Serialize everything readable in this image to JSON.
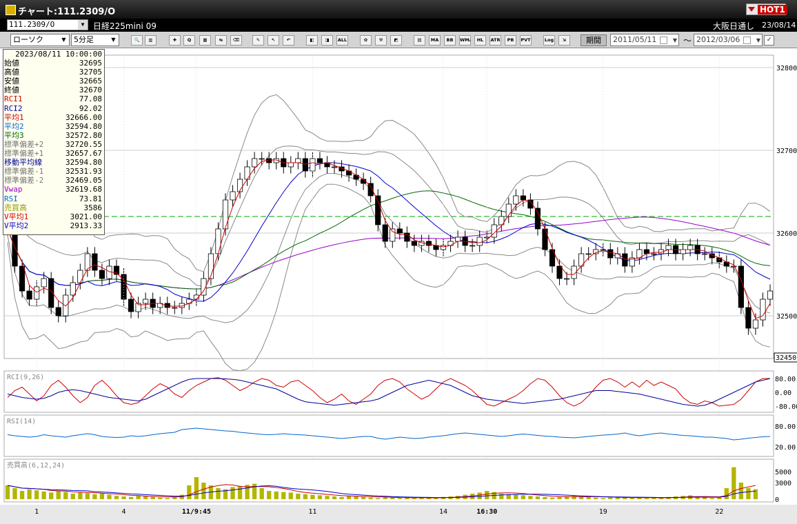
{
  "window": {
    "title": "チャート:111.2309/O",
    "hot_label": "HOT1"
  },
  "toolbar1": {
    "symbol": "111.2309/O",
    "product": "日経225mini 09",
    "session": "大阪日通し",
    "date": "23/08/14"
  },
  "toolbar2": {
    "chart_type": "ローソク",
    "interval": "5分足",
    "buttons": [
      {
        "name": "zoom-icon",
        "label": "🔍"
      },
      {
        "name": "scroll-icon",
        "label": "▥"
      },
      {
        "name": "cross-icon",
        "label": "✚"
      },
      {
        "name": "search-price-icon",
        "label": "Q"
      },
      {
        "name": "grid-icon",
        "label": "▦"
      },
      {
        "name": "split-icon",
        "label": "⇆"
      },
      {
        "name": "eraser-icon",
        "label": "⌫"
      },
      {
        "name": "pencil-icon",
        "label": "✎"
      },
      {
        "name": "cursor-icon",
        "label": "↖"
      },
      {
        "name": "undo-icon",
        "label": "↶"
      },
      {
        "name": "candle-left-icon",
        "label": "◧"
      },
      {
        "name": "candle-right-icon",
        "label": "◨"
      },
      {
        "name": "all-icon",
        "label": "ALL"
      },
      {
        "name": "gear-icon",
        "label": "✿"
      },
      {
        "name": "tool-icon",
        "label": "⚒"
      },
      {
        "name": "color-icon",
        "label": "◩"
      },
      {
        "name": "grid2-icon",
        "label": "▤"
      },
      {
        "name": "ma-icon",
        "label": "MA"
      },
      {
        "name": "bb-icon",
        "label": "BB"
      },
      {
        "name": "wma-icon",
        "label": "WMA"
      },
      {
        "name": "hl-icon",
        "label": "HL"
      },
      {
        "name": "atr-icon",
        "label": "ATR"
      },
      {
        "name": "pb-icon",
        "label": "PB"
      },
      {
        "name": "pvt-icon",
        "label": "PVT"
      },
      {
        "name": "log-icon",
        "label": "Log"
      },
      {
        "name": "exit-icon",
        "label": "⇲"
      }
    ],
    "period_label": "期間",
    "date_from": "2011/05/11",
    "date_to": "2012/03/06",
    "tilde": "〜",
    "check": "✓"
  },
  "info_panel": {
    "datetime": "2023/08/11  10:00:00",
    "rows": [
      {
        "label": "始値",
        "value": "32695",
        "color": "#000000"
      },
      {
        "label": "高値",
        "value": "32705",
        "color": "#000000"
      },
      {
        "label": "安値",
        "value": "32665",
        "color": "#000000"
      },
      {
        "label": "終値",
        "value": "32670",
        "color": "#000000"
      },
      {
        "label": "RCI1",
        "value": "77.08",
        "color": "#cc0000"
      },
      {
        "label": "RCI2",
        "value": "92.02",
        "color": "#000099"
      },
      {
        "label": "平均1",
        "value": "32666.00",
        "color": "#cc0000"
      },
      {
        "label": "平均2",
        "value": "32594.80",
        "color": "#0066cc"
      },
      {
        "label": "平均3",
        "value": "32572.80",
        "color": "#006600"
      },
      {
        "label": "標準偏差+2",
        "value": "32720.55",
        "color": "#777777"
      },
      {
        "label": "標準偏差+1",
        "value": "32657.67",
        "color": "#777777"
      },
      {
        "label": "移動平均線",
        "value": "32594.80",
        "color": "#000099"
      },
      {
        "label": "標準偏差-1",
        "value": "32531.93",
        "color": "#777777"
      },
      {
        "label": "標準偏差-2",
        "value": "32469.05",
        "color": "#777777"
      },
      {
        "label": "Vwap",
        "value": "32619.68",
        "color": "#9900cc"
      },
      {
        "label": "RSI",
        "value": "73.81",
        "color": "#0066cc"
      },
      {
        "label": "売買高",
        "value": "3586",
        "color": "#999900"
      },
      {
        "label": "V平均1",
        "value": "3021.00",
        "color": "#cc0000"
      },
      {
        "label": "V平均2",
        "value": "2913.33",
        "color": "#0000cc"
      }
    ]
  },
  "chart_data": {
    "type": "candlestick",
    "price_axis": {
      "min": 32450,
      "max": 32800,
      "ticks": [
        32800,
        32700,
        32600,
        32500
      ],
      "current_label": "32450"
    },
    "x_labels": [
      "1",
      "4",
      "11/9:45",
      "11",
      "14",
      "16:30",
      "19",
      "22"
    ],
    "x_labels_bold": [
      false,
      false,
      true,
      false,
      false,
      true,
      false,
      false
    ],
    "key_levels": [
      32620
    ],
    "key_levels_color": "#00aa00",
    "panels": [
      {
        "name": "RCI(9,26)",
        "ticks": [
          "80.00",
          "0.00",
          "-80.00"
        ],
        "range": [
          -100,
          100
        ]
      },
      {
        "name": "RSI(14)",
        "ticks": [
          "80.00",
          "20.00"
        ],
        "range": [
          0,
          100
        ]
      },
      {
        "name": "売買高(6,12,24)",
        "ticks": [
          "5000",
          "3000",
          "0"
        ],
        "range": [
          0,
          6500
        ]
      }
    ],
    "colors": {
      "up": "#ffffff",
      "down": "#000000",
      "ma1": "#cc0000",
      "ma2": "#0000cc",
      "ma3": "#006600",
      "bb": "#888888",
      "vwap": "#9900cc",
      "rsi": "#0066cc",
      "rci1": "#cc0000",
      "rci2": "#000099",
      "volume": "#b5b500"
    },
    "closes": [
      32605,
      32560,
      32530,
      32520,
      32535,
      32545,
      32510,
      32500,
      32525,
      32540,
      32555,
      32575,
      32555,
      32545,
      32560,
      32550,
      32520,
      32505,
      32515,
      32520,
      32510,
      32515,
      32510,
      32510,
      32515,
      32520,
      32525,
      32545,
      32575,
      32605,
      32640,
      32650,
      32665,
      32680,
      32690,
      32690,
      32685,
      32690,
      32680,
      32685,
      32690,
      32675,
      32690,
      32685,
      32680,
      32680,
      32675,
      32670,
      32665,
      32660,
      32645,
      32610,
      32590,
      32605,
      32600,
      32590,
      32585,
      32590,
      32585,
      32580,
      32585,
      32590,
      32595,
      32585,
      32585,
      32595,
      32595,
      32610,
      32620,
      32635,
      32645,
      32640,
      32630,
      32605,
      32580,
      32560,
      32545,
      32545,
      32560,
      32575,
      32575,
      32580,
      32580,
      32570,
      32575,
      32560,
      32570,
      32580,
      32575,
      32575,
      32580,
      32585,
      32575,
      32580,
      32585,
      32575,
      32575,
      32570,
      32565,
      32560,
      32560,
      32510,
      32485,
      32495,
      32520,
      32530
    ],
    "rci1": [
      -30,
      10,
      30,
      -10,
      -50,
      -20,
      40,
      70,
      30,
      -20,
      -60,
      -30,
      40,
      70,
      30,
      -20,
      -60,
      -70,
      -60,
      -20,
      20,
      50,
      30,
      -10,
      -30,
      10,
      40,
      60,
      80,
      85,
      70,
      40,
      10,
      30,
      60,
      80,
      70,
      40,
      30,
      60,
      70,
      40,
      10,
      -30,
      -60,
      -40,
      -10,
      -50,
      -70,
      -40,
      -10,
      40,
      70,
      80,
      60,
      20,
      -10,
      -40,
      -20,
      20,
      60,
      80,
      60,
      40,
      10,
      -30,
      -70,
      -80,
      -60,
      -40,
      -20,
      10,
      50,
      80,
      70,
      30,
      -20,
      -60,
      -80,
      -60,
      -20,
      30,
      70,
      80,
      60,
      30,
      60,
      30,
      70,
      40,
      60,
      40,
      20,
      -30,
      -60,
      -70,
      -50,
      -60,
      -80,
      -75,
      -70,
      -40,
      10,
      60,
      80,
      80
    ],
    "rci2": [
      -10,
      -20,
      -30,
      -35,
      -40,
      -35,
      -20,
      0,
      10,
      15,
      10,
      0,
      -10,
      -20,
      -30,
      -35,
      -40,
      -45,
      -50,
      -40,
      -20,
      0,
      20,
      40,
      60,
      75,
      80,
      80,
      80,
      80,
      78,
      75,
      70,
      60,
      50,
      40,
      30,
      20,
      0,
      -20,
      -40,
      -55,
      -60,
      -65,
      -70,
      -75,
      -70,
      -65,
      -60,
      -55,
      -50,
      -40,
      -20,
      0,
      20,
      40,
      50,
      60,
      70,
      60,
      50,
      40,
      20,
      0,
      -20,
      -30,
      -40,
      -45,
      -50,
      -55,
      -60,
      -65,
      -60,
      -55,
      -50,
      -45,
      -40,
      -30,
      -20,
      -10,
      0,
      10,
      10,
      10,
      5,
      0,
      -5,
      -10,
      -20,
      -30,
      -40,
      -50,
      -60,
      -70,
      -75,
      -80,
      -75,
      -60,
      -40,
      -20,
      0,
      20,
      40,
      60,
      70,
      80
    ],
    "rsi": [
      55,
      52,
      50,
      48,
      50,
      55,
      52,
      50,
      48,
      52,
      55,
      58,
      55,
      50,
      48,
      47,
      48,
      52,
      50,
      52,
      55,
      58,
      60,
      62,
      70,
      72,
      74,
      72,
      70,
      68,
      66,
      65,
      62,
      60,
      58,
      56,
      55,
      56,
      58,
      56,
      55,
      54,
      52,
      50,
      48,
      46,
      44,
      46,
      48,
      50,
      50,
      45,
      42,
      45,
      48,
      46,
      44,
      45,
      48,
      50,
      52,
      55,
      58,
      60,
      58,
      56,
      54,
      52,
      50,
      52,
      55,
      57,
      55,
      53,
      51,
      50,
      48,
      47,
      46,
      48,
      50,
      52,
      54,
      55,
      57,
      60,
      55,
      52,
      55,
      58,
      60,
      57,
      55,
      53,
      52,
      50,
      48,
      48,
      46,
      44,
      40,
      42,
      45,
      47,
      49,
      50
    ],
    "volume": [
      2500,
      2000,
      1500,
      1800,
      1600,
      1400,
      1200,
      1500,
      1300,
      1000,
      1200,
      1100,
      900,
      1000,
      800,
      600,
      500,
      400,
      600,
      500,
      400,
      300,
      200,
      400,
      800,
      2500,
      4000,
      3000,
      2500,
      2000,
      1800,
      2200,
      2400,
      2600,
      2800,
      2000,
      1500,
      1400,
      1300,
      1200,
      1000,
      900,
      800,
      700,
      600,
      500,
      400,
      600,
      500,
      400,
      300,
      200,
      400,
      300,
      200,
      300,
      200,
      300,
      200,
      300,
      400,
      500,
      600,
      800,
      1000,
      1200,
      1500,
      1300,
      1000,
      900,
      800,
      700,
      600,
      500,
      400,
      300,
      400,
      500,
      600,
      500,
      400,
      300,
      200,
      300,
      400,
      300,
      200,
      300,
      200,
      300,
      200,
      400,
      500,
      600,
      700,
      400,
      300,
      200,
      300,
      2000,
      5800,
      3000,
      2000,
      1800
    ]
  }
}
